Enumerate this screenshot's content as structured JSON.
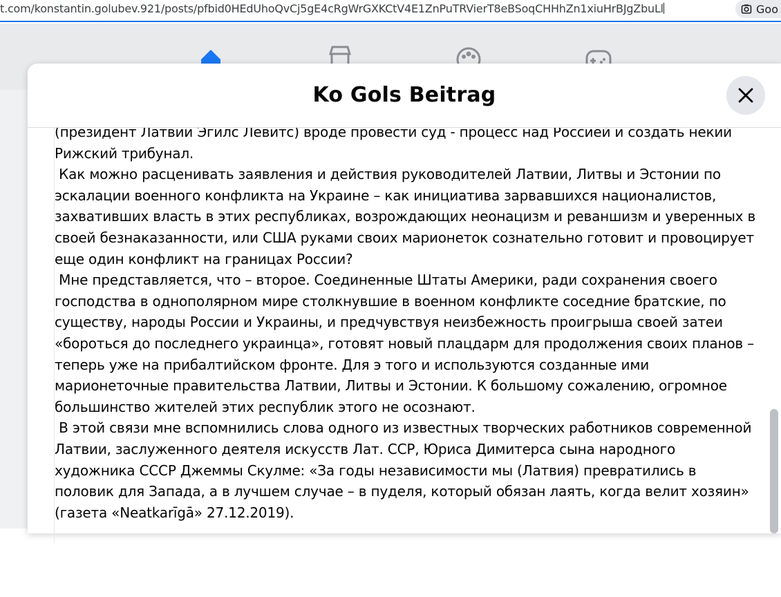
{
  "browser": {
    "url": "t.com/konstantin.golubev.921/posts/pfbid0HEdUhoQvCj5gE4cRgWrGXKCtV4E1ZnPuTRVierT8eBSoqCHHhZn1xiuHrBJgZbuLl",
    "lens_label": "Goo"
  },
  "nav": {
    "icons": [
      "home-icon",
      "marketplace-icon",
      "groups-icon",
      "gaming-icon"
    ],
    "accent": "#1877f2"
  },
  "modal": {
    "title": "Ko Gols Beitrag",
    "close_icon": "close-icon"
  },
  "post": {
    "paragraphs": [
      "(президент Латвии Эгилс Левитс) вроде провести суд - процесс над Россией и создать некий Рижский трибунал.",
      " Как можно расценивать заявления и действия руководителей Латвии, Литвы и Эстонии по эскалации военного конфликта на Украине – как инициатива зарвавшихся националистов, захвативших власть в этих республиках, возрождающих неонацизм и реваншизм и уверенных в своей безнаказанности, или США руками своих марионеток сознательно готовит и провоцирует еще один конфликт на границах России?",
      " Мне представляется, что – второе. Соединенные Штаты Америки, ради сохранения своего господства в однополярном мире столкнувшие в военном конфликте соседние братские, по существу, народы России и Украины, и предчувствуя неизбежность проигрыша своей затеи «бороться до последнего украинца», готовят новый плацдарм для продолжения своих планов – теперь уже на прибалтийском фронте. Для э того и используются созданные ими марионеточные правительства Латвии, Литвы и Эстонии. К большому сожалению, огромное большинство жителей этих республик этого не осознают.",
      " В этой связи мне вспомнились слова одного из известных творческих работников современной Латвии, заслуженного деятеля искусств Лат. ССР, Юриса Димитерса сына народного художника СССР Джеммы Скулме: «За годы независимости мы (Латвия) превратились в половик для Запада, а в лучшем случае – в пуделя, который обязан лаять, когда велит хозяин» (газета «Neatkarīgā» 27.12.2019)."
    ]
  }
}
